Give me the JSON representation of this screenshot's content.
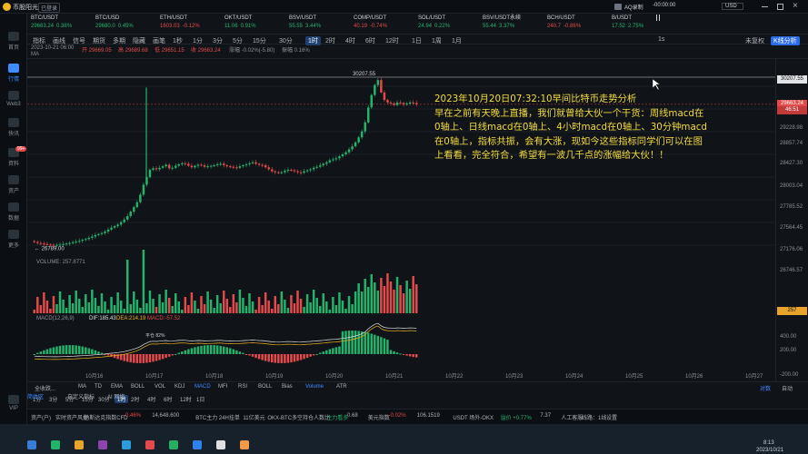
{
  "app": {
    "title": "币股阳光",
    "badge": "已登录"
  },
  "window": {
    "aq_label": "AQ录制",
    "timer": "-00:00:00",
    "currency": "USD"
  },
  "nav": [
    {
      "label": "首页"
    },
    {
      "label": "行情"
    },
    {
      "label": "Web3"
    },
    {
      "label": "快讯"
    },
    {
      "label": "資料",
      "badge": "99+"
    },
    {
      "label": "资产"
    },
    {
      "label": "数据"
    },
    {
      "label": "更多"
    },
    {
      "label": "VIP"
    }
  ],
  "tickers": [
    {
      "name": "BTC/USDT",
      "price": "29663.24",
      "change": "0.38%",
      "up": true
    },
    {
      "name": "BTC/USD",
      "price": "29680.0",
      "change": "0.45%",
      "up": true
    },
    {
      "name": "ETH/USDT",
      "price": "1603.03",
      "change": "-0.12%",
      "up": false
    },
    {
      "name": "OKT/USDT",
      "price": "11.06",
      "change": "0.91%",
      "up": true
    },
    {
      "name": "BSV/USDT",
      "price": "55.55",
      "change": "3.44%",
      "up": true
    },
    {
      "name": "COMP/USDT",
      "price": "40.19",
      "change": "-0.74%",
      "up": false
    },
    {
      "name": "SOL/USDT",
      "price": "24.94",
      "change": "0.22%",
      "up": true
    },
    {
      "name": "BSV/USDT永续",
      "price": "55.44",
      "change": "3.37%",
      "up": true
    },
    {
      "name": "BCH/USDT",
      "price": "240.7",
      "change": "-0.86%",
      "up": false
    },
    {
      "name": "B/USDT",
      "price": "17.52",
      "change": "2.75%",
      "up": true
    }
  ],
  "toolbar1": {
    "items": [
      "指标",
      "画线",
      "信号",
      "期货",
      "多期",
      "隐藏",
      "画笔",
      "1秒",
      "1分",
      "3分",
      "5分",
      "15分",
      "30分",
      "1时",
      "2时",
      "4时",
      "6时",
      "12时",
      "1日",
      "1周",
      "1月"
    ],
    "active": "1时",
    "scale": "1s",
    "mode": "未复权",
    "kline": "K线分析"
  },
  "toolbar2": {
    "items": [
      "主力",
      "大额",
      "筹"
    ],
    "times": [
      "1分",
      "3分",
      "5分",
      "15分",
      "30分",
      "1时",
      "2时",
      "4时",
      "6时",
      "12时",
      "1日"
    ],
    "active": "1时"
  },
  "info_row": {
    "date": "2023-10-21 06:00",
    "open": "开 29669.05",
    "high": "高 29689.68",
    "low": "低 29651.15",
    "close": "收 29663.24",
    "chg": "涨幅 -0.02%(-5.80)",
    "amp": "振幅 0.16%"
  },
  "ma_label": "MA",
  "volume_label": "VOLUME: 257.8771",
  "macd_label": "MACD(12,26,9)",
  "macd_values": {
    "dif": "DIF:185.43",
    "dea": "DEA:214.19",
    "macd": "MACD:-57.52"
  },
  "high_label": "30207.55",
  "low_label": "26789.00",
  "y_axis": [
    "30207.55",
    "29663.24",
    "46:51",
    "29228.98",
    "28857.74",
    "28427.30",
    "28003.04",
    "27785.52",
    "27564.45",
    "27176.06",
    "26746.57",
    "257",
    "400.00",
    "200.00",
    "-200.00"
  ],
  "x_axis": [
    "10月16",
    "10月17",
    "10月18",
    "10月19",
    "10月20",
    "10月21",
    "10月22",
    "10月23",
    "10月24",
    "10月25",
    "10月26",
    "10月27"
  ],
  "annotation": "2023年10月20日07:32:10早间比特币走势分析\n早在之前有天晚上直播，我们就曾给大伙一个干货：周线macd在0轴上、日线macd在0轴上、4小时macd在0轴上、30分钟macd在0轴上，指标共振，会有大涨，现如今这些指标同学们可以在图上看看，完全符合，希望有一波几千点的涨幅给大伙！！",
  "indicator_bar": {
    "items": [
      "MA",
      "TD",
      "EMA",
      "BOLL",
      "VOL",
      "KDJ",
      "MACD",
      "MFI",
      "RSI",
      "BOLL",
      "Bias",
      "Volume",
      "ATR"
    ],
    "left": "全收跌...",
    "right1": "对数",
    "right2": "自动"
  },
  "bottom_tabs": [
    "简体区",
    "自定义指标",
    "AI 网络"
  ],
  "bottom_tip": "平仓 82%",
  "tickerbar": {
    "items": [
      "资产(户)",
      "实时资产风控",
      "纳斯达克指数CFD",
      "-0.46%",
      "14,648.600",
      "BTC主力 24H挂单",
      "11亿美元",
      "OKX-BTC多空持仓人数比",
      "主力看多",
      "0.68",
      "美元指数",
      "-0.02%",
      "106.1519",
      "USDT 场外-OKX",
      "溢价 +0.77%",
      "7.37",
      "人工客服",
      "线路：1线",
      "设置"
    ]
  },
  "clock": {
    "time": "8:13",
    "date": "2023/10/21"
  },
  "chart_data": {
    "type": "candlestick",
    "interval": "1时",
    "ylim": [
      26746.57,
      30207.55
    ],
    "last_price": 29663.24,
    "high": 30207.55,
    "low": 26789.0,
    "closes": [
      26900,
      26880,
      26870,
      26860,
      26850,
      26845,
      26838,
      26842,
      26850,
      26860,
      26870,
      26880,
      26895,
      26910,
      26925,
      26945,
      26960,
      26985,
      27010,
      27040,
      27060,
      27080,
      27110,
      27150,
      27190,
      27220,
      27250,
      27300,
      27350,
      27420,
      27510,
      27600,
      27700,
      27850,
      28050,
      28200,
      28350,
      28380,
      28360,
      28390,
      28420,
      28450,
      28380,
      28390,
      28430,
      28460,
      28480,
      28470,
      28430,
      28400,
      28430,
      28450,
      28440,
      28410,
      28420,
      28430,
      28440,
      28460,
      28470,
      28440,
      28420,
      28410,
      28400,
      28390,
      28420,
      28440,
      28460,
      28480,
      28500,
      28470,
      28450,
      28440,
      28400,
      28360,
      28320,
      28300,
      28290,
      28300,
      28330,
      28350,
      28340,
      28320,
      28300,
      28290,
      28320,
      28340,
      28360,
      28390,
      28410,
      28440,
      28470,
      28500,
      28540,
      28560,
      28580,
      28620,
      28660,
      28700,
      28760,
      28820,
      28900,
      29000,
      29120,
      29300,
      29600,
      29850,
      30050,
      30150,
      29900,
      29750,
      29700,
      29680,
      29650,
      29700,
      29690,
      29660,
      29680,
      29700,
      29690,
      29663.24
    ]
  }
}
